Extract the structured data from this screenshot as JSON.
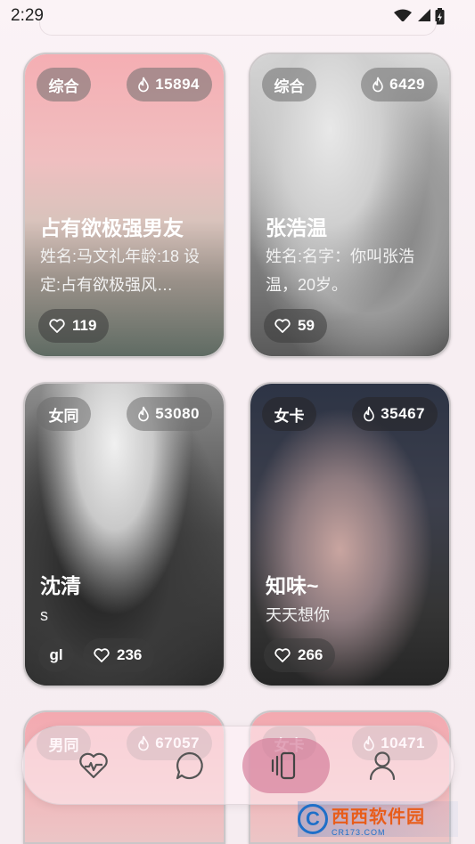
{
  "status_bar": {
    "time": "2:29"
  },
  "cards": [
    {
      "tag": "综合",
      "heat": "15894",
      "title": "占有欲极强男友",
      "desc": "姓名:马文礼年龄:18 设定:占有欲极强风…",
      "likes": "119"
    },
    {
      "tag": "综合",
      "heat": "6429",
      "title": "张浩温",
      "desc": "姓名:名字：你叫张浩温，20岁。",
      "likes": "59"
    },
    {
      "tag": "女同",
      "heat": "53080",
      "title": "沈清",
      "desc": "s",
      "extra_tag": "gl",
      "likes": "236"
    },
    {
      "tag": "女卡",
      "heat": "35467",
      "title": "知味~",
      "desc": "天天想你",
      "likes": "266"
    },
    {
      "tag": "男同",
      "heat": "67057"
    },
    {
      "tag": "女卡",
      "heat": "10471"
    }
  ],
  "bottom_nav": {
    "items": [
      {
        "icon": "heart-pulse-icon"
      },
      {
        "icon": "chat-bubble-icon"
      },
      {
        "icon": "card-stack-icon",
        "active": true
      },
      {
        "icon": "profile-icon"
      }
    ],
    "active_color": "#d27896"
  },
  "watermark": {
    "brand": "西西软件园",
    "url": "CR173.COM"
  }
}
